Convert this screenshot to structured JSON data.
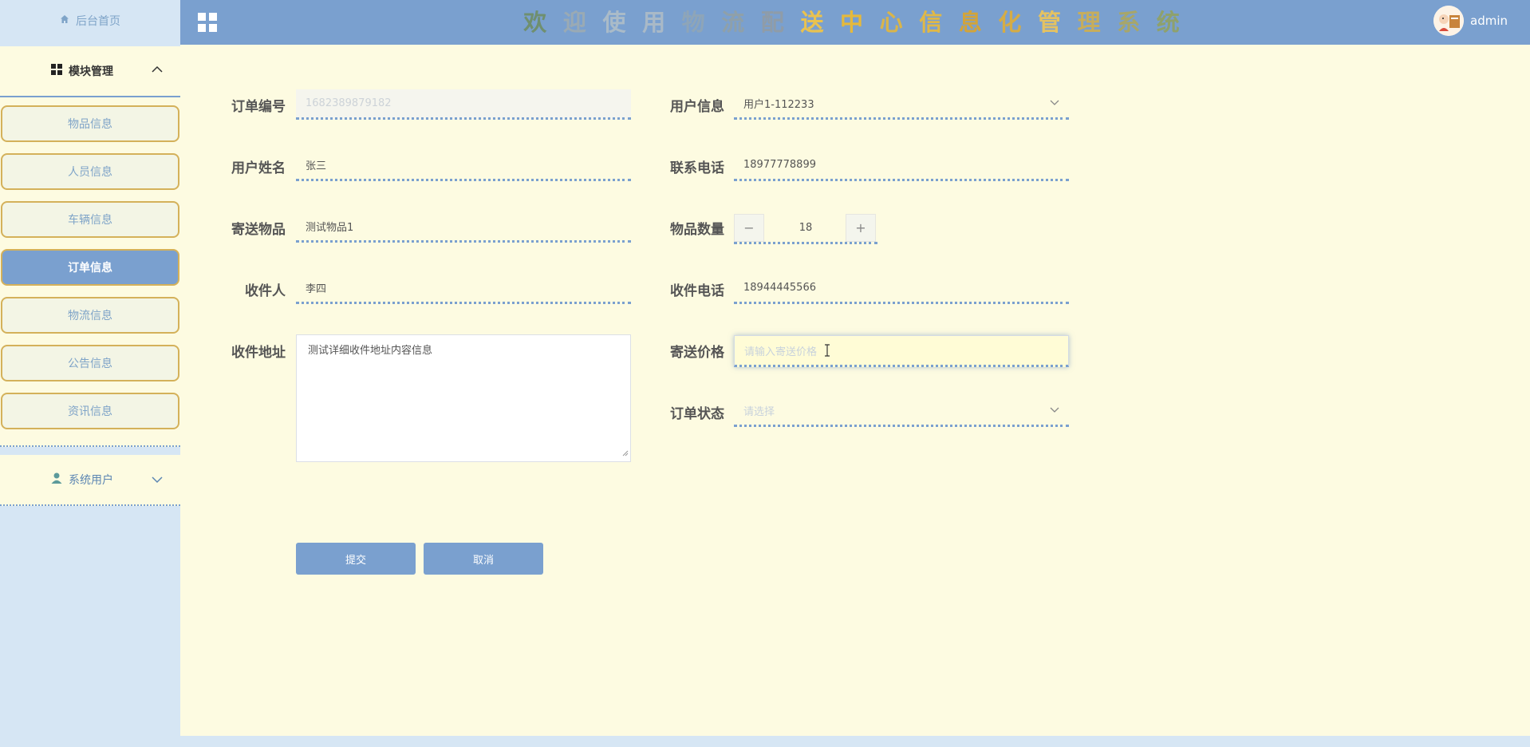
{
  "sidebar": {
    "home_label": "后台首页",
    "group_label": "模块管理",
    "items": [
      {
        "label": "物品信息"
      },
      {
        "label": "人员信息"
      },
      {
        "label": "车辆信息"
      },
      {
        "label": "订单信息",
        "active": true
      },
      {
        "label": "物流信息"
      },
      {
        "label": "公告信息"
      },
      {
        "label": "资讯信息"
      }
    ],
    "user_label": "系统用户"
  },
  "header": {
    "title": "欢迎使用物流配送中心信息化管理系统",
    "title_colors": [
      "#6f8f6f",
      "#9aaab4",
      "#aabbc8",
      "#a9b9c7",
      "#8ea5b8",
      "#8fa0a9",
      "#8f9ca8",
      "#e9c24f",
      "#e6b93b",
      "#d9b54a",
      "#e0b846",
      "#d2a43a",
      "#d5ac45",
      "#e4c262",
      "#c6ad5c",
      "#a7a66a",
      "#8ea16d"
    ],
    "username": "admin"
  },
  "form": {
    "order_no": {
      "label": "订单编号",
      "value": "1682389879182"
    },
    "user_info": {
      "label": "用户信息",
      "value": "用户1-112233"
    },
    "user_name": {
      "label": "用户姓名",
      "value": "张三"
    },
    "phone": {
      "label": "联系电话",
      "value": "18977778899"
    },
    "item": {
      "label": "寄送物品",
      "value": "测试物品1"
    },
    "quantity": {
      "label": "物品数量",
      "value": "18",
      "minus": "−",
      "plus": "+"
    },
    "receiver": {
      "label": "收件人",
      "value": "李四"
    },
    "receiver_phone": {
      "label": "收件电话",
      "value": "18944445566"
    },
    "address": {
      "label": "收件地址",
      "value": "测试详细收件地址内容信息"
    },
    "price": {
      "label": "寄送价格",
      "placeholder": "请输入寄送价格"
    },
    "status": {
      "label": "订单状态",
      "placeholder": "请选择"
    },
    "submit_label": "提交",
    "cancel_label": "取消"
  },
  "colors": {
    "accent": "#7aa0cf",
    "main_bg": "#fdfbe1",
    "sidebar_bg": "#d6e6f4",
    "item_border": "#d4b15a"
  }
}
